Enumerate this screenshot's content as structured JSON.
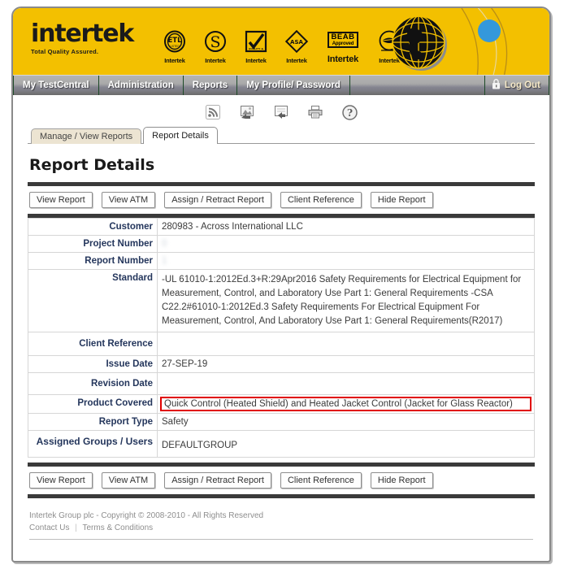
{
  "brand": {
    "name": "intertek",
    "tagline": "Total Quality Assured.",
    "banner_color": "#f3c000",
    "accent_blue": "#3498db"
  },
  "certification_marks": [
    {
      "id": "etl-mark",
      "symbol": "ETL",
      "caption": "Intertek"
    },
    {
      "id": "s-mark",
      "symbol": "S",
      "caption": "Intertek"
    },
    {
      "id": "check-mark",
      "symbol": "✔",
      "caption": "Intertek"
    },
    {
      "id": "asta-mark",
      "symbol": "ASA",
      "caption": "Intertek"
    },
    {
      "id": "beab-mark",
      "symbol": "BEAB",
      "symbol2": "Approved",
      "caption": "Intertek"
    },
    {
      "id": "leaf-mark",
      "symbol": "◉",
      "caption": "Intertek"
    }
  ],
  "nav": {
    "items": [
      {
        "id": "my-testcentral",
        "label": "My TestCentral"
      },
      {
        "id": "administration",
        "label": "Administration"
      },
      {
        "id": "reports",
        "label": "Reports"
      },
      {
        "id": "my-profile-password",
        "label": "My Profile/ Password"
      }
    ],
    "logout": {
      "label": "Log Out",
      "icon": "lock-icon"
    }
  },
  "toolbar": {
    "icons": [
      {
        "id": "rss-feed-icon",
        "title": "RSS Feed"
      },
      {
        "id": "export-image-icon",
        "title": "Export Image"
      },
      {
        "id": "export-download-icon",
        "title": "Export"
      },
      {
        "id": "print-icon",
        "title": "Print"
      },
      {
        "id": "help-icon",
        "title": "Help"
      }
    ]
  },
  "tabs": [
    {
      "id": "manage-view-reports",
      "label": "Manage / View Reports",
      "active": false
    },
    {
      "id": "report-details",
      "label": "Report Details",
      "active": true
    }
  ],
  "page": {
    "title": "Report Details"
  },
  "actions": [
    {
      "id": "view-report",
      "label": "View Report"
    },
    {
      "id": "view-atm",
      "label": "View ATM"
    },
    {
      "id": "assign-retract-report",
      "label": "Assign / Retract Report"
    },
    {
      "id": "client-reference",
      "label": "Client Reference"
    },
    {
      "id": "hide-report",
      "label": "Hide Report"
    }
  ],
  "details": {
    "customer_label": "Customer",
    "customer_value": "280983 - Across International LLC",
    "project_number_label": "Project Number",
    "project_number_value": "0",
    "report_number_label": "Report Number",
    "report_number_value": "1",
    "standard_label": "Standard",
    "standard_value": "-UL 61010-1:2012Ed.3+R:29Apr2016 Safety Requirements for Electrical Equipment for Measurement, Control, and Laboratory Use Part 1: General Requirements -CSA C22.2#61010-1:2012Ed.3 Safety Requirements For Electrical Equipment For Measurement, Control, And Laboratory Use Part 1: General Requirements(R2017)",
    "client_reference_label": "Client Reference",
    "client_reference_value": "",
    "issue_date_label": "Issue Date",
    "issue_date_value": "27-SEP-19",
    "revision_date_label": "Revision Date",
    "revision_date_value": "",
    "product_covered_label": "Product Covered",
    "product_covered_value": "Quick Control (Heated Shield) and Heated Jacket Control (Jacket for Glass Reactor)",
    "report_type_label": "Report Type",
    "report_type_value": "Safety",
    "assigned_groups_label": "Assigned Groups / Users",
    "assigned_groups_value": "DEFAULTGROUP",
    "highlight_color": "#e00000"
  },
  "footer": {
    "copyright": "Intertek Group plc - Copyright © 2008-2010 - All Rights Reserved",
    "contact": "Contact Us",
    "terms": "Terms & Conditions"
  }
}
